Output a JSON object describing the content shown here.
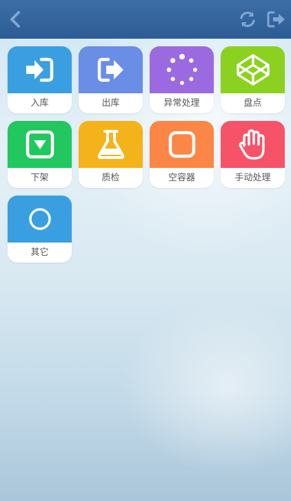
{
  "header": {
    "back_icon": "chevron-left-icon",
    "refresh_icon": "refresh-icon",
    "logout_icon": "logout-icon",
    "bar_color": "#2d5c95",
    "icon_color": "#7ea7d6"
  },
  "tiles": [
    {
      "label": "入库",
      "icon": "sign-in-icon",
      "color": "#3a9fe0"
    },
    {
      "label": "出库",
      "icon": "sign-out-icon",
      "color": "#6a8de6"
    },
    {
      "label": "异常处理",
      "icon": "spinner-icon",
      "color": "#9b6ae0"
    },
    {
      "label": "盘点",
      "icon": "codepen-icon",
      "color": "#8ad21f"
    },
    {
      "label": "下架",
      "icon": "caret-square-down-icon",
      "color": "#22c75f"
    },
    {
      "label": "质检",
      "icon": "flask-icon",
      "color": "#f4b31a"
    },
    {
      "label": "空容器",
      "icon": "square-outline-icon",
      "color": "#fb8645"
    },
    {
      "label": "手动处理",
      "icon": "hand-icon",
      "color": "#f65368"
    },
    {
      "label": "其它",
      "icon": "circle-outline-icon",
      "color": "#3a9fe0"
    }
  ]
}
